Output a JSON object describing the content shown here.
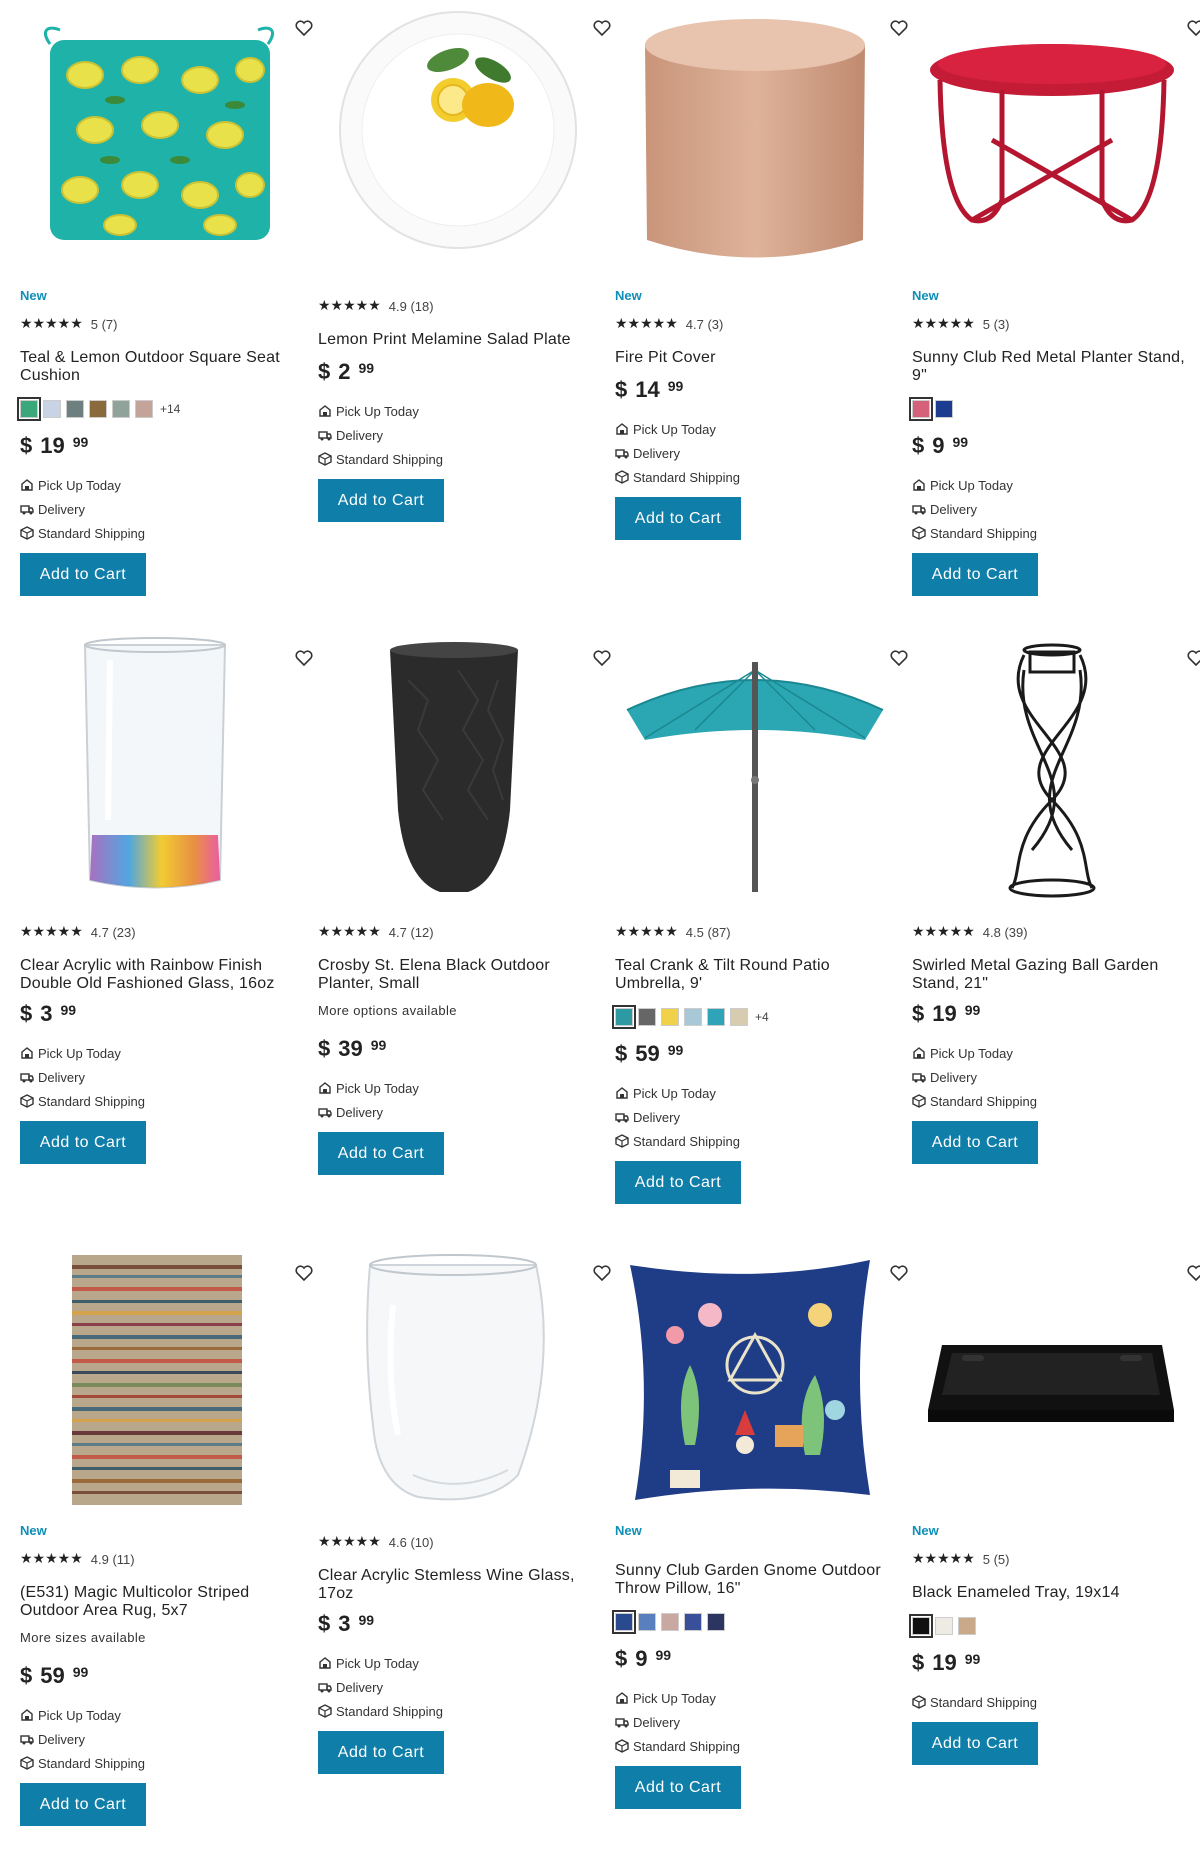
{
  "products": [
    {
      "new": "New",
      "stars": "★★★★★",
      "rating": "5 (7)",
      "name": "Teal & Lemon Outdoor Square Seat Cushion",
      "swatches": [
        "#3aa87a",
        "#c9d3e6",
        "#6e7f80",
        "#8a6a3d",
        "#8fa39a",
        "#c4a39b"
      ],
      "swatch_more": "+14",
      "price_dollars": "19",
      "price_cents": "99",
      "fulfillment": [
        "Pick Up Today",
        "Delivery",
        "Standard Shipping"
      ],
      "cart": "Add to Cart"
    },
    {
      "stars": "★★★★★",
      "rating": "4.9 (18)",
      "name": "Lemon Print Melamine Salad Plate",
      "price_dollars": "2",
      "price_cents": "99",
      "fulfillment": [
        "Pick Up Today",
        "Delivery",
        "Standard Shipping"
      ],
      "cart": "Add to Cart"
    },
    {
      "new": "New",
      "stars": "★★★★★",
      "rating": "4.7 (3)",
      "name": "Fire Pit Cover",
      "price_dollars": "14",
      "price_cents": "99",
      "fulfillment": [
        "Pick Up Today",
        "Delivery",
        "Standard Shipping"
      ],
      "cart": "Add to Cart"
    },
    {
      "new": "New",
      "stars": "★★★★★",
      "rating": "5 (3)",
      "name": "Sunny Club Red Metal Planter Stand, 9\"",
      "swatches": [
        "#d4607a",
        "#1c3d8f"
      ],
      "price_dollars": "9",
      "price_cents": "99",
      "fulfillment": [
        "Pick Up Today",
        "Delivery",
        "Standard Shipping"
      ],
      "cart": "Add to Cart"
    },
    {
      "stars": "★★★★★",
      "rating": "4.7 (23)",
      "name": "Clear Acrylic with Rainbow Finish Double Old Fashioned Glass, 16oz",
      "price_dollars": "3",
      "price_cents": "99",
      "fulfillment": [
        "Pick Up Today",
        "Delivery",
        "Standard Shipping"
      ],
      "cart": "Add to Cart"
    },
    {
      "stars": "★★★★★",
      "rating": "4.7 (12)",
      "name": "Crosby St. Elena Black Outdoor Planter, Small",
      "more": "More options available",
      "price_dollars": "39",
      "price_cents": "99",
      "fulfillment": [
        "Pick Up Today",
        "Delivery"
      ],
      "cart": "Add to Cart"
    },
    {
      "stars": "★★★★★",
      "rating": "4.5 (87)",
      "name": "Teal Crank & Tilt Round Patio Umbrella, 9'",
      "swatches": [
        "#2d9aa3",
        "#666666",
        "#f2d14a",
        "#a8c8d8",
        "#2fa3b8",
        "#d8ccb0"
      ],
      "swatch_more": "+4",
      "price_dollars": "59",
      "price_cents": "99",
      "fulfillment": [
        "Pick Up Today",
        "Delivery",
        "Standard Shipping"
      ],
      "cart": "Add to Cart"
    },
    {
      "stars": "★★★★★",
      "rating": "4.8 (39)",
      "name": "Swirled Metal Gazing Ball Garden Stand, 21\"",
      "price_dollars": "19",
      "price_cents": "99",
      "fulfillment": [
        "Pick Up Today",
        "Delivery",
        "Standard Shipping"
      ],
      "cart": "Add to Cart"
    },
    {
      "new": "New",
      "stars": "★★★★★",
      "rating": "4.9 (11)",
      "name": "(E531) Magic Multicolor Striped Outdoor Area Rug, 5x7",
      "more": "More sizes available",
      "price_dollars": "59",
      "price_cents": "99",
      "fulfillment": [
        "Pick Up Today",
        "Delivery",
        "Standard Shipping"
      ],
      "cart": "Add to Cart"
    },
    {
      "stars": "★★★★★",
      "rating": "4.6 (10)",
      "name": "Clear Acrylic Stemless Wine Glass, 17oz",
      "price_dollars": "3",
      "price_cents": "99",
      "fulfillment": [
        "Pick Up Today",
        "Delivery",
        "Standard Shipping"
      ],
      "cart": "Add to Cart"
    },
    {
      "new": "New",
      "stars": "★★★★★",
      "rating": "",
      "name": "Sunny Club Garden Gnome Outdoor Throw Pillow, 16\"",
      "swatches": [
        "#2a4a8f",
        "#5a7fbf",
        "#c8a8a0",
        "#3a4f9a",
        "#2c3560"
      ],
      "price_dollars": "9",
      "price_cents": "99",
      "fulfillment": [
        "Pick Up Today",
        "Delivery",
        "Standard Shipping"
      ],
      "cart": "Add to Cart"
    },
    {
      "new": "New",
      "stars": "★★★★★",
      "rating": "5 (5)",
      "name": "Black Enameled Tray, 19x14",
      "swatches": [
        "#111111",
        "#eeeae4",
        "#c9a98a"
      ],
      "price_dollars": "19",
      "price_cents": "99",
      "fulfillment": [
        "Standard Shipping"
      ],
      "cart": "Add to Cart"
    }
  ],
  "currency": "$",
  "colors": {
    "brand_button": "#0f7ea8",
    "new_badge": "#0f8fb8"
  }
}
